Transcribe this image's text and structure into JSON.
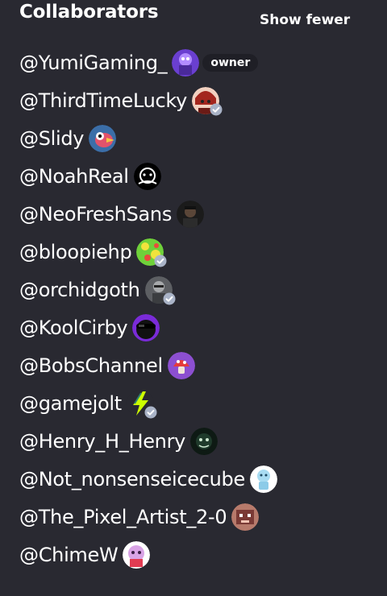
{
  "header": {
    "title": "Collaborators",
    "toggle_label": "Show fewer"
  },
  "owner_badge_label": "owner",
  "collaborators": [
    {
      "handle": "@YumiGaming_",
      "avatar": "purple-character-avatar",
      "verified": false,
      "owner": true
    },
    {
      "handle": "@ThirdTimeLucky",
      "avatar": "red-character-avatar",
      "verified": true,
      "owner": false
    },
    {
      "handle": "@Slidy",
      "avatar": "bird-avatar",
      "verified": false,
      "owner": false
    },
    {
      "handle": "@NoahReal",
      "avatar": "black-white-avatar",
      "verified": false,
      "owner": false
    },
    {
      "handle": "@NeoFreshSans",
      "avatar": "dark-figure-avatar",
      "verified": false,
      "owner": false
    },
    {
      "handle": "@bloopiehp",
      "avatar": "green-yellow-avatar",
      "verified": true,
      "owner": false
    },
    {
      "handle": "@orchidgoth",
      "avatar": "grey-figure-avatar",
      "verified": true,
      "owner": false
    },
    {
      "handle": "@KoolCirby",
      "avatar": "purple-sunglasses-avatar",
      "verified": false,
      "owner": false
    },
    {
      "handle": "@BobsChannel",
      "avatar": "purple-mushroom-avatar",
      "verified": false,
      "owner": false
    },
    {
      "handle": "@gamejolt",
      "avatar": "gamejolt-bolt-avatar",
      "verified": true,
      "owner": false
    },
    {
      "handle": "@Henry_H_Henry",
      "avatar": "dark-green-avatar",
      "verified": false,
      "owner": false
    },
    {
      "handle": "@Not_nonsenseicecube",
      "avatar": "ice-cube-avatar",
      "verified": false,
      "owner": false
    },
    {
      "handle": "@The_Pixel_Artist_2-0",
      "avatar": "pixel-creature-avatar",
      "verified": false,
      "owner": false
    },
    {
      "handle": "@ChimeW",
      "avatar": "pink-character-avatar",
      "verified": false,
      "owner": false
    }
  ],
  "colors": {
    "background": "#292931",
    "text": "#ffffff",
    "badge_background": "#1f1f26",
    "verified_badge": "#a9b3c7"
  }
}
